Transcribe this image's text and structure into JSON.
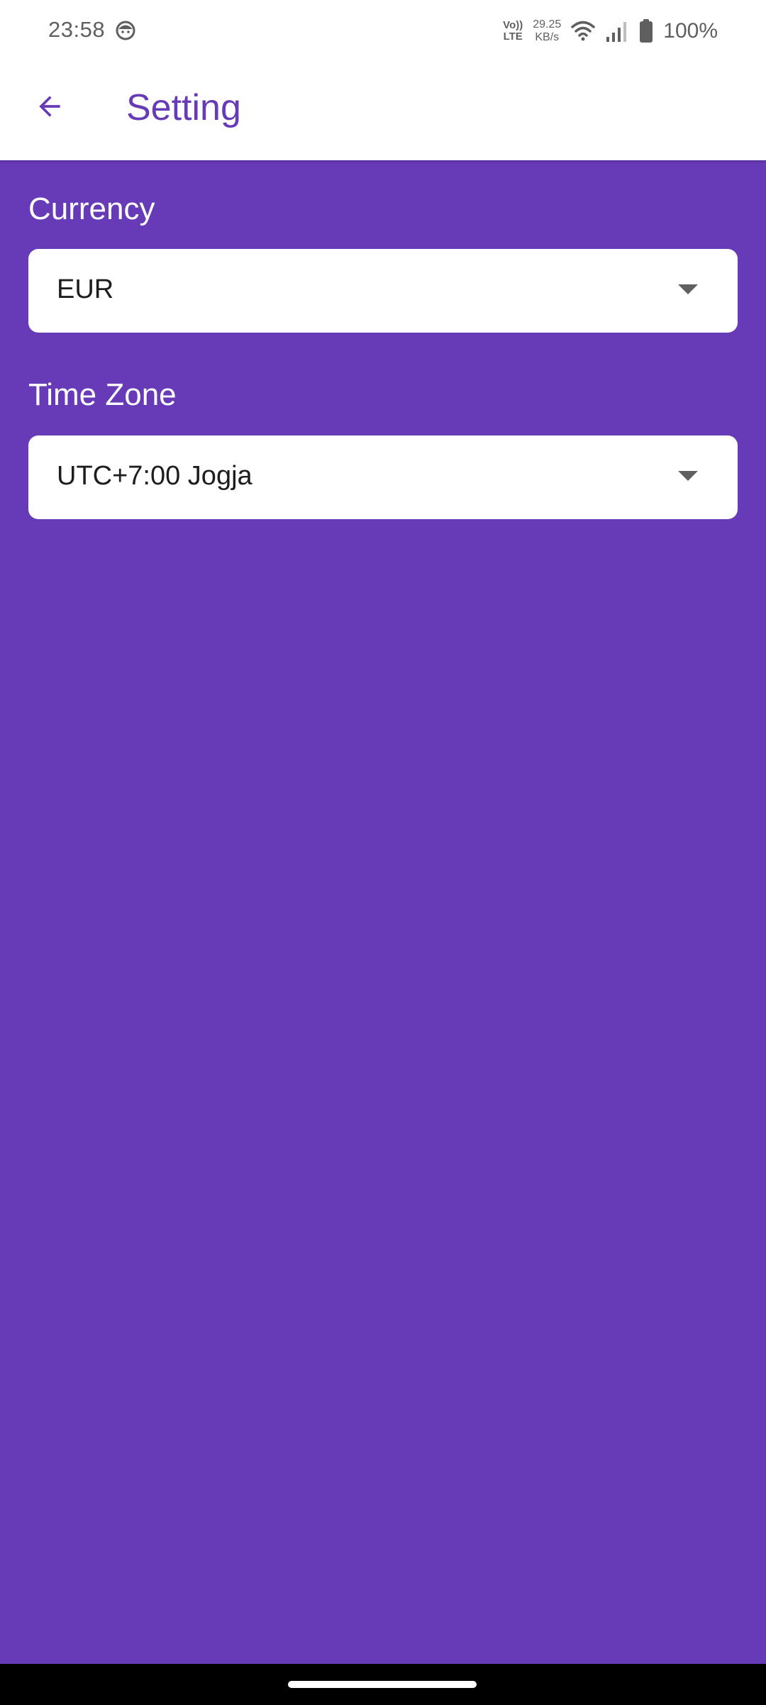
{
  "status_bar": {
    "time": "23:58",
    "volte_top": "Vo))",
    "volte_bottom": "LTE",
    "speed_value": "29.25",
    "speed_unit": "KB/s",
    "battery": "100%"
  },
  "app_bar": {
    "title": "Setting"
  },
  "settings": {
    "currency": {
      "label": "Currency",
      "value": "EUR"
    },
    "time_zone": {
      "label": "Time Zone",
      "value": "UTC+7:00 Jogja"
    }
  },
  "icons": {
    "back": "arrow-back-icon",
    "dropdown": "caret-down-icon",
    "notification": "face-notification-icon",
    "wifi": "wifi-icon",
    "signal": "signal-icon",
    "battery": "battery-icon"
  },
  "colors": {
    "primary": "#673ab7",
    "surface": "#ffffff",
    "status_text": "#5f5f5f"
  }
}
